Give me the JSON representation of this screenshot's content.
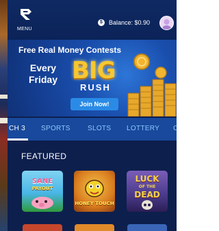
{
  "header": {
    "menu_label": "MENU",
    "balance_text": "Balance: $0.90",
    "icons": [
      "logo-icon",
      "coin-icon",
      "avatar"
    ]
  },
  "banner": {
    "title": "Free Real Money Contests",
    "line1": "Every",
    "line2": "Friday",
    "big": "BIG",
    "rush": "RUSH",
    "join_label": "Join Now!"
  },
  "nav": {
    "tabs": [
      {
        "label": "CH 3"
      },
      {
        "label": "SPORTS"
      },
      {
        "label": "SLOTS"
      },
      {
        "label": "LOTTERY"
      },
      {
        "label": "C"
      }
    ]
  },
  "featured": {
    "heading": "FEATURED",
    "games": [
      {
        "title_top": "SANE",
        "title_bottom": "PAYOUT"
      },
      {
        "title_top": "HONEY TOUCH"
      },
      {
        "title_top": "LUCK",
        "title_mid": "OF THE",
        "title_bottom": "DEAD"
      }
    ]
  },
  "colors": {
    "header_bg": "#0f2a63",
    "nav_bg": "#18499c",
    "nav_text": "#8fc7ff",
    "accent_gold": "#f7c731",
    "button_blue": "#2a8be6"
  }
}
